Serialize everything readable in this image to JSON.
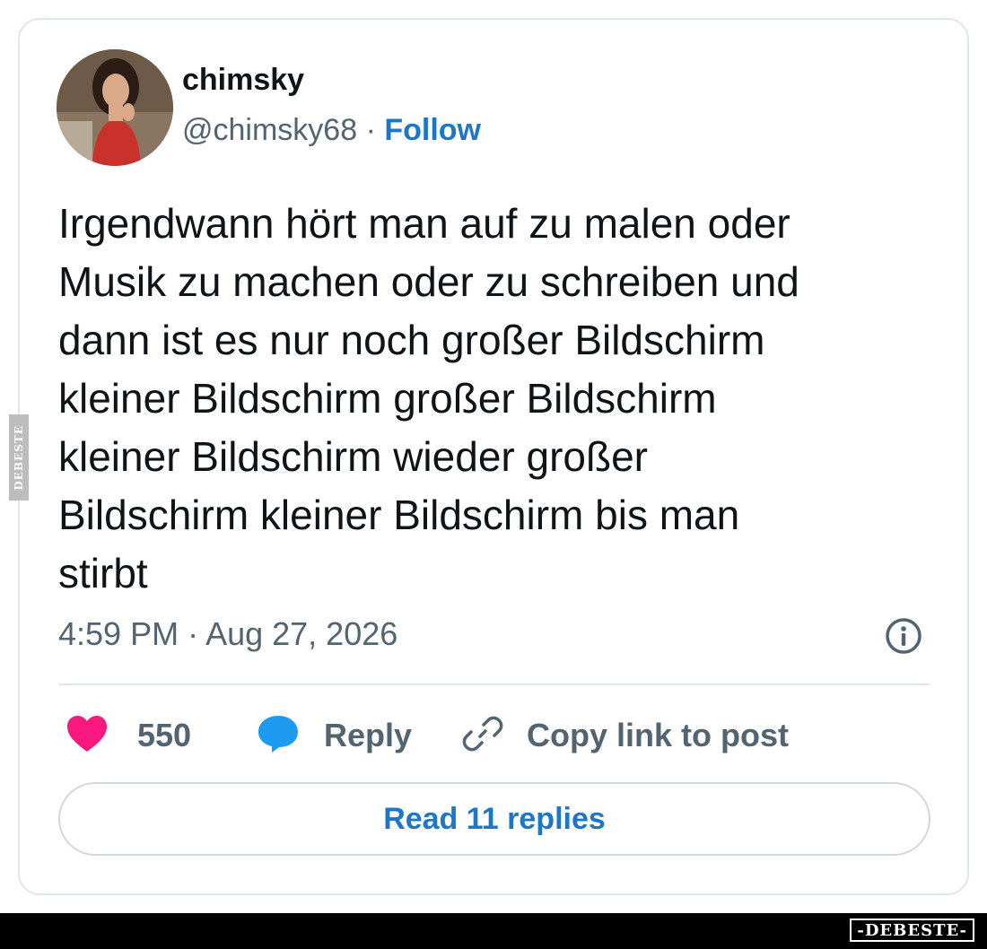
{
  "author": {
    "display_name": "chimsky",
    "handle": "@chimsky68",
    "separator": " · ",
    "follow_label": "Follow"
  },
  "tweet": {
    "text": "Irgendwann hört man auf zu malen oder\nMusik zu machen oder zu schreiben und\ndann ist es nur noch großer Bildschirm\nkleiner Bildschirm großer Bildschirm\nkleiner Bildschirm wieder großer\nBildschirm kleiner Bildschirm bis man\nstirbt",
    "timestamp": "4:59 PM · Aug 27, 2026"
  },
  "actions": {
    "like_count": "550",
    "reply_label": "Reply",
    "copy_link_label": "Copy link to post"
  },
  "read_replies_label": "Read 11 replies",
  "watermark": {
    "side_text": "DEBESTE",
    "footer_text": "-DEBESTE-"
  },
  "colors": {
    "like": "#f91880",
    "reply": "#1d9bf0",
    "link": "#1d77c8",
    "muted": "#536471"
  },
  "icons": {
    "like": "heart-icon",
    "reply": "speech-bubble-icon",
    "copy_link": "link-icon",
    "info": "info-icon"
  }
}
